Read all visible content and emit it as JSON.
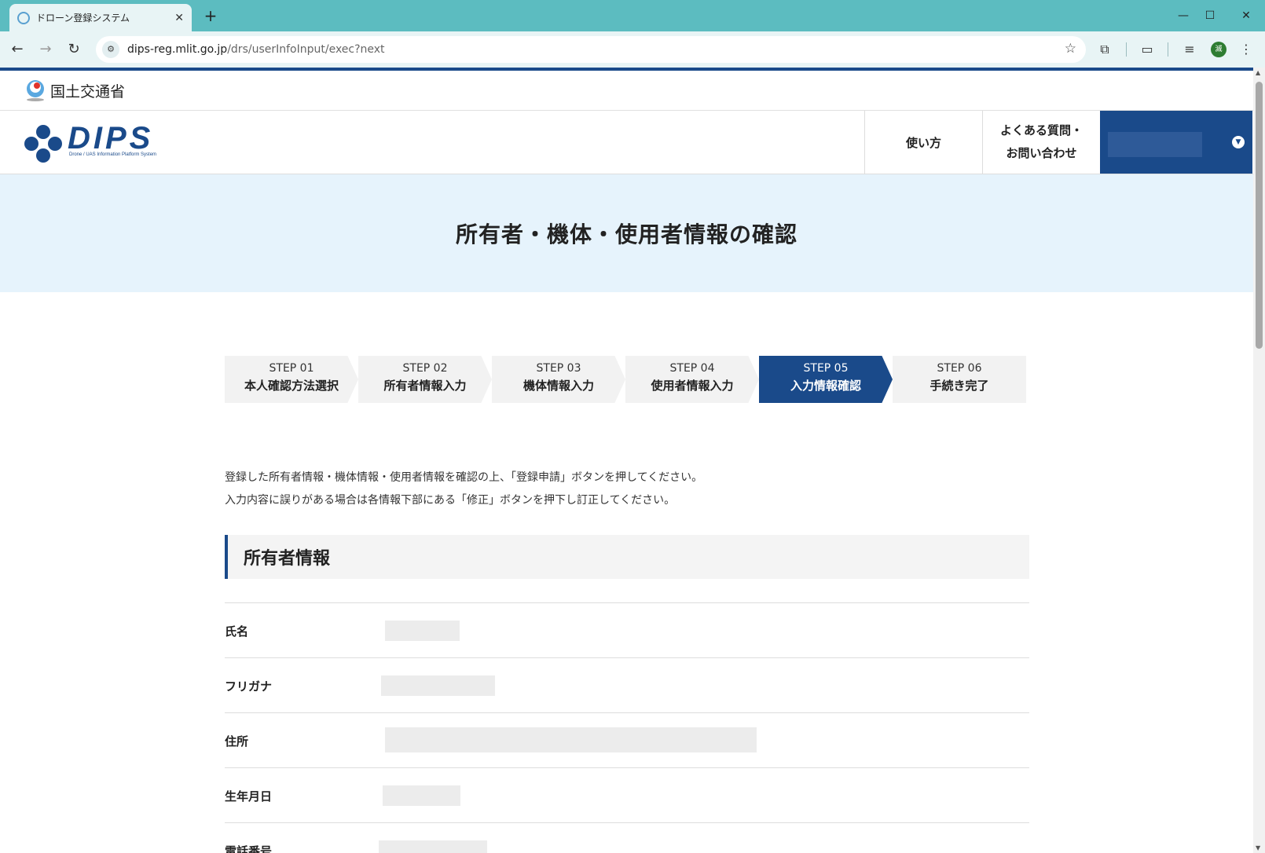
{
  "browser": {
    "tab_title": "ドローン登録システム",
    "tab_close": "✕",
    "new_tab": "+",
    "url_host": "dips-reg.mlit.go.jp",
    "url_path": "/drs/userInfoInput/exec?next",
    "profile_initial": "滅",
    "window_controls": {
      "minimize": "—",
      "maximize": "☐",
      "close": "✕"
    }
  },
  "gov": {
    "name": "国土交通省"
  },
  "header": {
    "logo_text": "DIPS",
    "logo_subtitle": "Drone / UAS Information Platform System",
    "nav_usage": "使い方",
    "nav_faq_line1": "よくある質問・",
    "nav_faq_line2": "お問い合わせ"
  },
  "hero": {
    "title": "所有者・機体・使用者情報の確認"
  },
  "steps": [
    {
      "num": "STEP 01",
      "label": "本人確認方法選択",
      "active": false
    },
    {
      "num": "STEP 02",
      "label": "所有者情報入力",
      "active": false
    },
    {
      "num": "STEP 03",
      "label": "機体情報入力",
      "active": false
    },
    {
      "num": "STEP 04",
      "label": "使用者情報入力",
      "active": false
    },
    {
      "num": "STEP 05",
      "label": "入力情報確認",
      "active": true
    },
    {
      "num": "STEP 06",
      "label": "手続き完了",
      "active": false
    }
  ],
  "intro": {
    "line1": "登録した所有者情報・機体情報・使用者情報を確認の上、「登録申請」ボタンを押してください。",
    "line2": "入力内容に誤りがある場合は各情報下部にある「修正」ボタンを押下し訂正してください。"
  },
  "owner_section": {
    "title": "所有者情報",
    "rows": [
      {
        "label": "氏名"
      },
      {
        "label": "フリガナ"
      },
      {
        "label": "住所"
      },
      {
        "label": "生年月日"
      },
      {
        "label": "電話番号"
      }
    ]
  },
  "colors": {
    "brand": "#1a4a8a",
    "hero_bg": "#e6f3fc",
    "tab_bar": "#5cbcc0"
  }
}
